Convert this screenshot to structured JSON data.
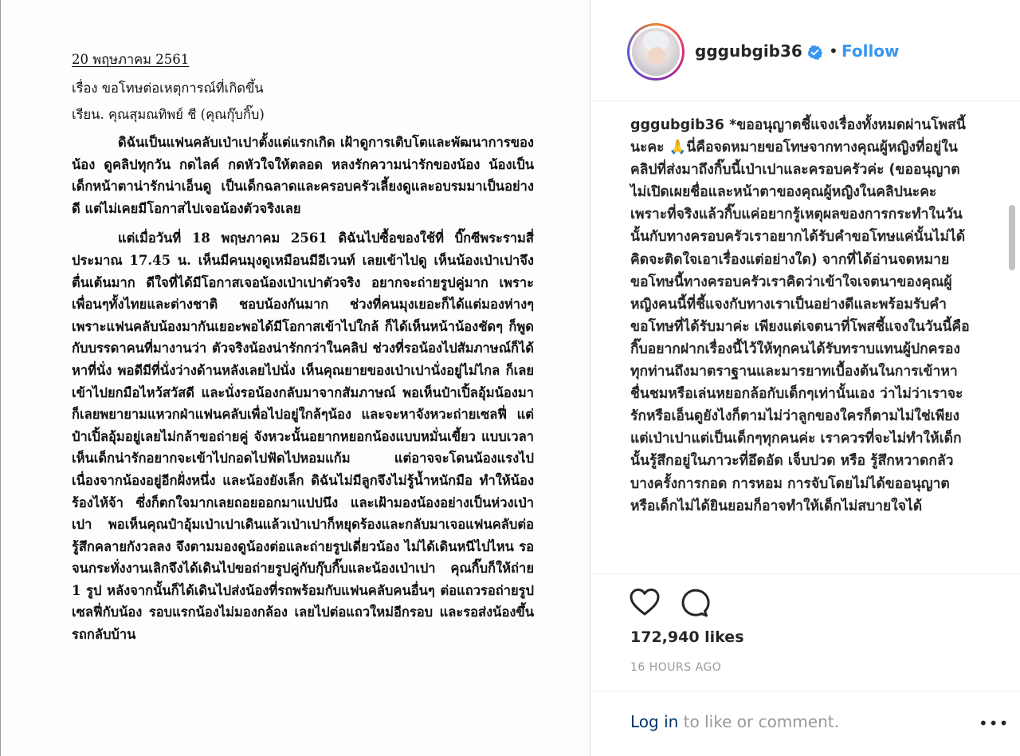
{
  "post_image": {
    "letter": {
      "date": "20 พฤษภาคม 2561",
      "subject": "เรื่อง ขอโทษต่อเหตุการณ์ที่เกิดขึ้น",
      "salutation": "เรียน. คุณสุมณทิพย์ ชี (คุณกุ๊บกิ๊บ)",
      "paragraph_1": "ดิฉันเป็นแฟนคลับเป่าเปาตั้งแต่แรกเกิด เฝ้าดูการเติบโตและพัฒนาการของน้อง ดูคลิปทุกวัน กดไลค์ กดหัวใจให้ตลอด หลงรักความน่ารักของน้อง น้องเป็นเด็กหน้าตาน่ารักน่าเอ็นดู เป็นเด็กฉลาดและครอบครัวเลี้ยงดูและอบรมมาเป็นอย่างดี แต่ไม่เคยมีโอกาสไปเจอน้องตัวจริงเลย",
      "paragraph_2": "แต่เมื่อวันที่ 18 พฤษภาคม 2561 ดิฉันไปซื้อของใช้ที่ บิ๊กซีพระรามสี่ ประมาณ 17.45 น. เห็นมีคนมุงดูเหมือนมีอีเวนท์ เลยเข้าไปดู เห็นน้องเป่าเปาจึงตื่นเต้นมาก ดีใจที่ได้มีโอกาสเจอน้องเป่าเปาตัวจริง อยากจะถ่ายรูปคู่มาก เพราะเพื่อนๆทั้งไทยและต่างชาติ ชอบน้องกันมาก ช่วงที่คนมุงเยอะก็ได้แต่มองห่างๆ เพราะแฟนคลับน้องมากันเยอะพอได้มีโอกาสเข้าไปใกล้ ก็ได้เห็นหน้าน้องชัดๆ ก็พูดกับบรรดาคนที่มางานว่า ตัวจริงน้องน่ารักกว่าในคลิป ช่วงที่รอน้องไปสัมภาษณ์ก็ได้หาที่นั่ง พอดีมีที่นั่งว่างด้านหลังเลยไปนั่ง เห็นคุณยายของเป่าเปานั่งอยู่ไม่ไกล ก็เลยเข้าไปยกมือไหว้สวัสดี และนั่งรอน้องกลับมาจากสัมภาษณ์ พอเห็นป๋าเปิ้ลอุ้มน้องมาก็เลยพยายามแหวกฝ่าแฟนคลับเพื่อไปอยู่ใกล้ๆน้อง และจะหาจังหวะถ่ายเซลฟี่ แต่ป๋าเปิ้ลอุ้มอยู่เลยไม่กล้าขอถ่ายคู่ จังหวะนั้นอยากหยอกน้องแบบหมั่นเขี้ยว แบบเวลาเห็นเด็กน่ารักอยากจะเข้าไปกอดไปฟัดไปหอมแก้ม แต่อาจจะโดนน้องแรงไปเนื่องจากน้องอยู่อีกฝั่งหนึ่ง และน้องยังเล็ก ดิฉันไม่มีลูกจึงไม่รู้น้ำหนักมือ ทำให้น้องร้องไห้จ้า ซึ่งก็ตกใจมากเลยถอยออกมาแปปนึง และเฝ้ามองน้องอย่างเป็นห่วงเป่าเปา พอเห็นคุณป๋าอุ้มเป่าเปาเดินแล้วเป่าเปาก็หยุดร้องและกลับมาเจอแฟนคลับต่อ รู้สึกคลายกังวลลง จึงตามมองดูน้องต่อและถ่ายรูปเดี่ยวน้อง ไม่ได้เดินหนีไปไหน รอจนกระทั่งงานเลิกจึงได้เดินไปขอถ่ายรูปคู่กับกุ๊บกิ๊บและน้องเป่าเปา คุณกิ๊บก็ให้ถ่าย 1 รูป หลังจากนั้นก็ได้เดินไปส่งน้องที่รถพร้อมกับแฟนคลับคนอื่นๆ ต่อแถวรอถ่ายรูปเซลฟี่กับน้อง รอบแรกน้องไม่มองกล้อง เลยไปต่อแถวใหม่อีกรอบ และรอส่งน้องขึ้นรถกลับบ้าน"
    }
  },
  "header": {
    "username": "gggubgib36",
    "separator": "•",
    "follow_label": "Follow"
  },
  "caption": {
    "username": "gggubgib36",
    "text": "*ขออนุญาตชี้แจงเรื่องทั้งหมดผ่านโพสนี้นะคะ 🙏นี่คือจดหมายขอโทษจากทางคุณผู้หญิงที่อยู่ในคลิปที่ส่งมาถึงกิ๊บนี้เป่าเปาและครอบครัวค่ะ (ขออนุญาตไม่เปิดเผยชื่อและหน้าตาของคุณผู้หญิงในคลิปนะคะ เพราะที่จริงแล้วกิ๊บแค่อยากรู้เหตุผลของการกระทำในวันนั้นกับทางครอบครัวเราอยากได้รับคำขอโทษแค่นั้นไม่ได้คิดจะติดใจเอาเรื่องแต่อย่างใด) จากที่ได้อ่านจดหมายขอโทษนี้ทางครอบครัวเราคิดว่าเข้าใจเจตนาของคุณผู้หญิงคนนี้ที่ชี้แจงกับทางเราเป็นอย่างดีและพร้อมรับคำขอโทษที่ได้รับมาค่ะ เพียงแต่เจตนาที่โพสชี้แจงในวันนี้คือกิ๊บอยากฝากเรื่องนี้ไว้ให้ทุกคนได้รับทราบแทนผู้ปกครองทุกท่านถึงมาตราฐานและมารยาทเบื้องต้นในการเข้าหาชื่นชมหรือเล่นหยอกล้อกับเด็กๆเท่านั้นเอง ว่าไม่ว่าเราจะรักหรือเอ็นดูยังไงก็ตามไม่ว่าลูกของใครก็ตามไม่ใช่เพียงแต่เป่าเปาแต่เป็นเด็กๆทุกคนค่ะ เราควรที่จะไม่ทำให้เด็กนั้นรู้สึกอยู่ในภาวะที่อึดอัด เจ็บปวด หรือ รู้สึกหวาดกลัว บางครั้งการกอด การหอม การจับโดยไม่ได้ขออนุญาตหรือเด็กไม่ได้ยินยอมก็อาจทำให้เด็กไม่สบายใจได้"
  },
  "actions": {
    "like_icon": "heart-outline-icon",
    "comment_icon": "comment-bubble-icon",
    "likes": "172,940 likes",
    "timestamp": "16 HOURS AGO"
  },
  "footer": {
    "login_link": "Log in",
    "login_rest": " to like or comment.",
    "more_label": "•••"
  },
  "colors": {
    "follow": "#3897f0",
    "verified": "#3897f0",
    "text": "#262626",
    "muted": "#999999",
    "link": "#003569"
  }
}
